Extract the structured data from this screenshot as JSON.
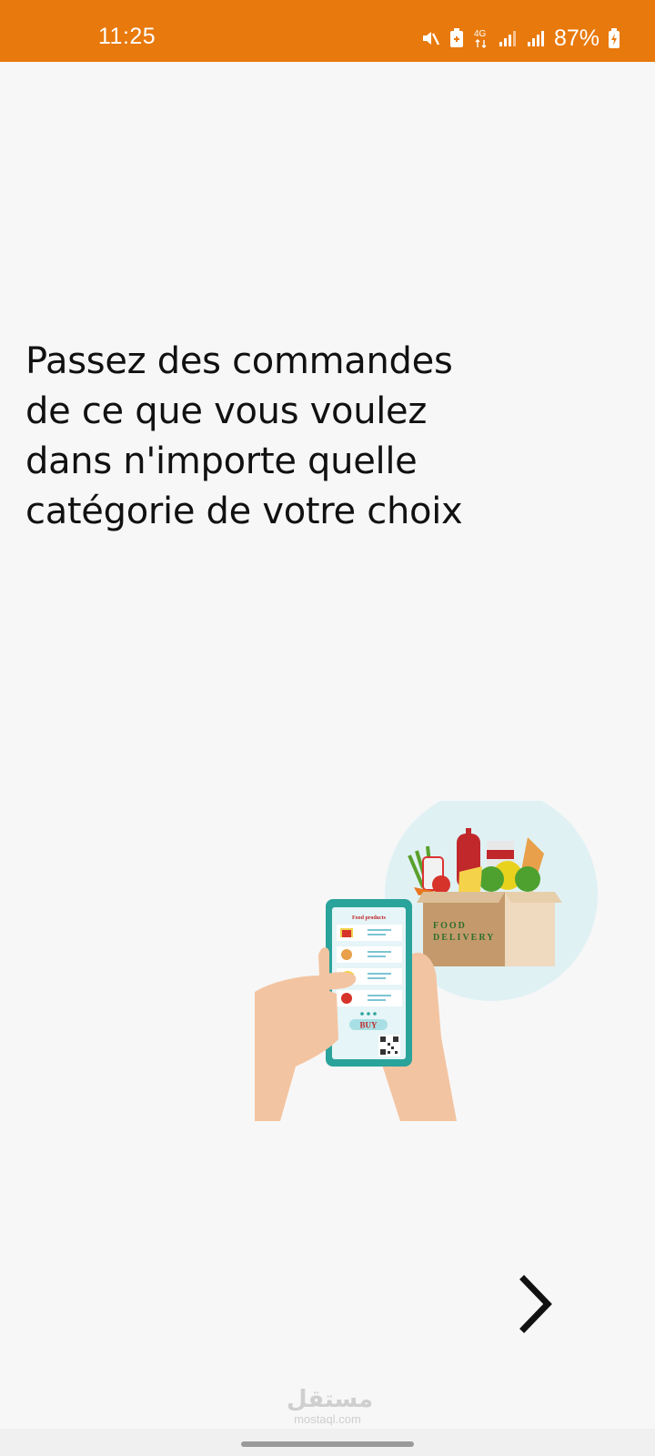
{
  "status_bar": {
    "time": "11:25",
    "network": "4G",
    "battery": "87%",
    "icons": [
      "mute-icon",
      "battery-saver-icon",
      "network-4g-icon",
      "signal-icon",
      "signal-icon",
      "battery-charging-icon"
    ]
  },
  "onboarding": {
    "headline": "Passez des commandes de ce que vous voulez dans n'importe quelle catégorie de votre choix",
    "illustration": {
      "phone_title": "Food products",
      "buy_label": "BUY",
      "box_label_line1": "FOOD",
      "box_label_line2": "DELIVERY"
    },
    "next_icon": "chevron-right-icon"
  },
  "watermark": {
    "arabic": "مستقل",
    "latin": "mostaql.com"
  },
  "colors": {
    "status_bar": "#e8790c",
    "background": "#f7f7f7",
    "text": "#111111"
  }
}
